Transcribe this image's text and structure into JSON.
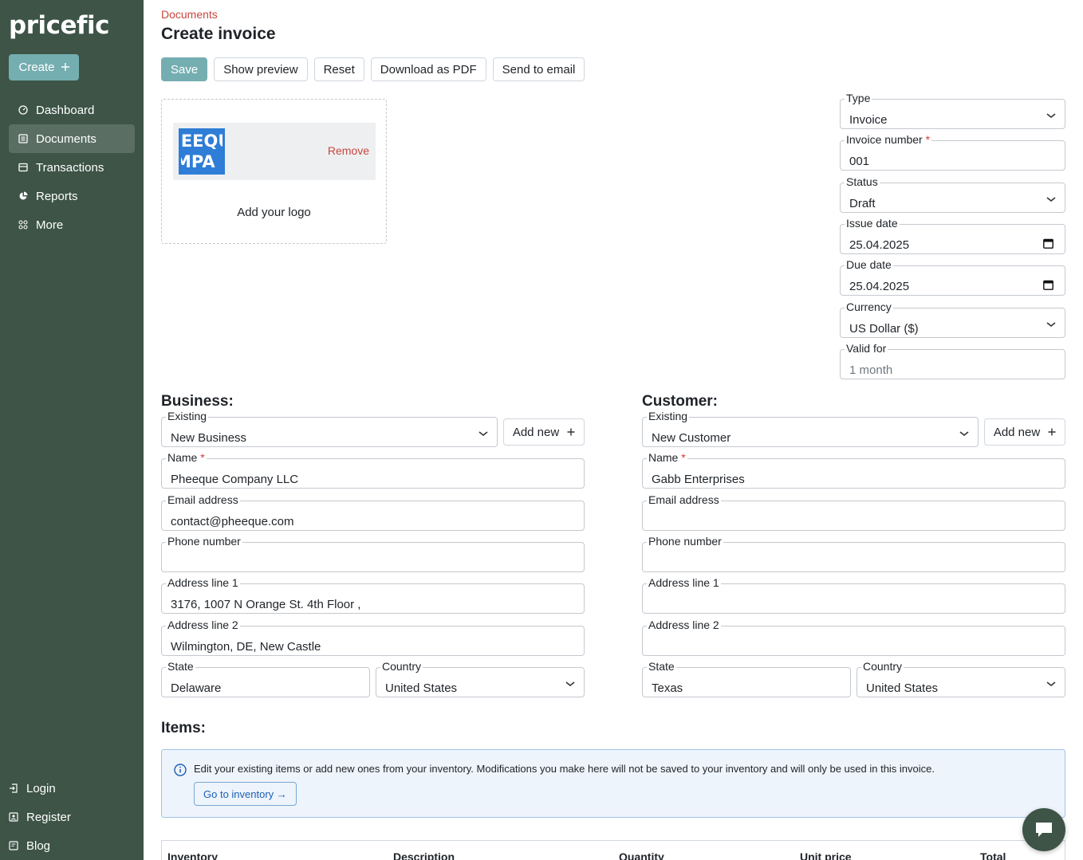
{
  "app": {
    "logo": "pricefic",
    "create_label": "Create"
  },
  "nav": {
    "items": [
      {
        "label": "Dashboard",
        "icon": "dashboard-icon"
      },
      {
        "label": "Documents",
        "icon": "document-icon",
        "active": true
      },
      {
        "label": "Transactions",
        "icon": "transactions-icon"
      },
      {
        "label": "Reports",
        "icon": "pie-chart-icon"
      },
      {
        "label": "More",
        "icon": "grid-icon"
      }
    ],
    "bottom": [
      {
        "label": "Login",
        "icon": "login-icon"
      },
      {
        "label": "Register",
        "icon": "register-icon"
      },
      {
        "label": "Blog",
        "icon": "blog-icon"
      }
    ]
  },
  "header": {
    "breadcrumb": "Documents",
    "title": "Create invoice"
  },
  "toolbar": {
    "save": "Save",
    "preview": "Show preview",
    "reset": "Reset",
    "pdf": "Download as PDF",
    "email": "Send to email"
  },
  "logo_box": {
    "image_text_top": "IEEQU",
    "image_text_bottom": "MPA",
    "remove": "Remove",
    "add_logo": "Add your logo"
  },
  "meta": {
    "type": {
      "label": "Type",
      "value": "Invoice"
    },
    "invoice_number": {
      "label": "Invoice number",
      "value": "001"
    },
    "status": {
      "label": "Status",
      "value": "Draft"
    },
    "issue_date": {
      "label": "Issue date",
      "value": "25.04.2025"
    },
    "due_date": {
      "label": "Due date",
      "value": "25.04.2025"
    },
    "currency": {
      "label": "Currency",
      "value": "US Dollar ($)"
    },
    "valid_for": {
      "label": "Valid for",
      "placeholder": "1 month"
    }
  },
  "business": {
    "title": "Business:",
    "existing": {
      "label": "Existing",
      "value": "New Business"
    },
    "add_new": "Add new",
    "name": {
      "label": "Name",
      "value": "Pheeque Company LLC"
    },
    "email": {
      "label": "Email address",
      "value": "contact@pheeque.com"
    },
    "phone": {
      "label": "Phone number",
      "value": ""
    },
    "address1": {
      "label": "Address line 1",
      "value": "3176, 1007 N Orange St. 4th Floor ,"
    },
    "address2": {
      "label": "Address line 2",
      "value": "Wilmington, DE, New Castle"
    },
    "state": {
      "label": "State",
      "value": "Delaware"
    },
    "country": {
      "label": "Country",
      "value": "United States"
    }
  },
  "customer": {
    "title": "Customer:",
    "existing": {
      "label": "Existing",
      "value": "New Customer"
    },
    "add_new": "Add new",
    "name": {
      "label": "Name",
      "value": "Gabb Enterprises"
    },
    "email": {
      "label": "Email address",
      "value": ""
    },
    "phone": {
      "label": "Phone number",
      "value": ""
    },
    "address1": {
      "label": "Address line 1",
      "value": ""
    },
    "address2": {
      "label": "Address line 2",
      "value": ""
    },
    "state": {
      "label": "State",
      "value": "Texas"
    },
    "country": {
      "label": "Country",
      "value": "United States"
    }
  },
  "items": {
    "title": "Items:",
    "info": "Edit your existing items or add new ones from your inventory. Modifications you make here will not be saved to your inventory and will only be used in this invoice.",
    "inventory_button": "Go to inventory →",
    "columns": [
      "Inventory",
      "Description",
      "Quantity",
      "Unit price",
      "Total"
    ]
  },
  "colors": {
    "sidebar": "#3d5447",
    "accent": "#75aeb1",
    "danger": "#c9473f",
    "info_bg": "#eef4fb"
  }
}
